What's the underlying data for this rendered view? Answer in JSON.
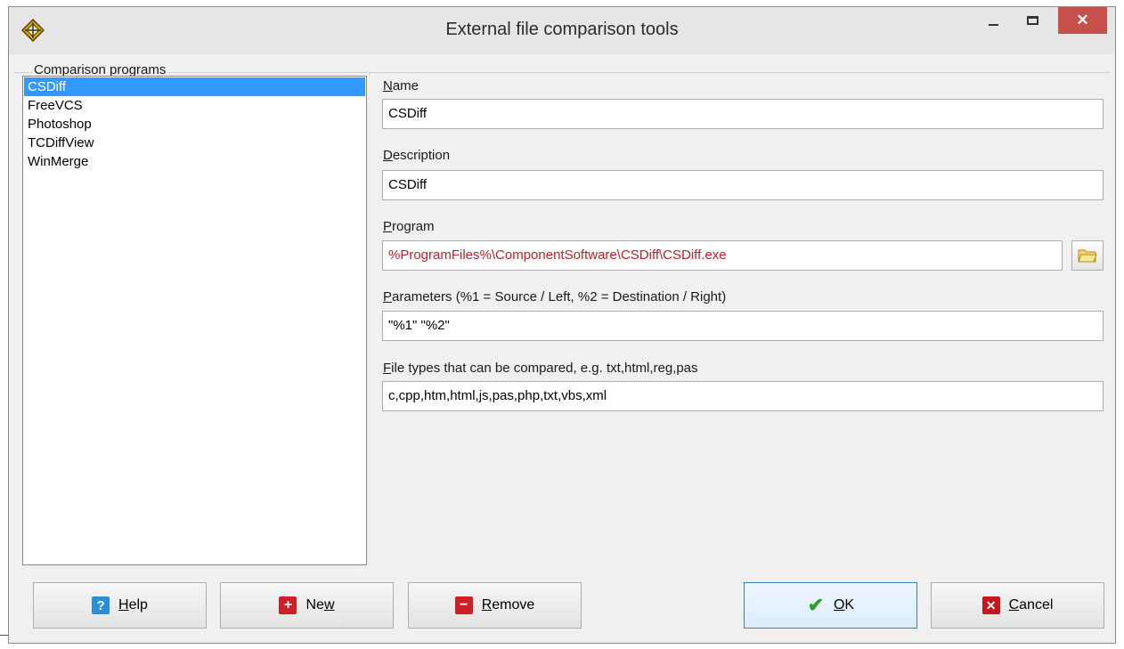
{
  "window": {
    "title": "External file comparison tools",
    "close_symbol": "✕"
  },
  "list_group": {
    "label": "Comparison programs",
    "items": [
      {
        "label": "CSDiff",
        "selected": true
      },
      {
        "label": "FreeVCS",
        "selected": false
      },
      {
        "label": "Photoshop",
        "selected": false
      },
      {
        "label": "TCDiffView",
        "selected": false
      },
      {
        "label": "WinMerge",
        "selected": false
      }
    ]
  },
  "fields": {
    "name": {
      "label_key": "N",
      "label_rest": "ame",
      "value": "CSDiff"
    },
    "description": {
      "label_key": "D",
      "label_rest": "escription",
      "value": "CSDiff"
    },
    "program": {
      "label_key": "P",
      "label_rest": "rogram",
      "value": "%ProgramFiles%\\ComponentSoftware\\CSDiff\\CSDiff.exe",
      "value_color": "#c0202a"
    },
    "parameters": {
      "label_key": "P",
      "label_rest": "arameters (%1 = Source / Left, %2 = Destination / Right)",
      "value": "\"%1\" \"%2\""
    },
    "file_types": {
      "label_key": "F",
      "label_rest": "ile types that can be compared, e.g. txt,html,reg,pas",
      "value": "c,cpp,htm,html,js,pas,php,txt,vbs,xml"
    }
  },
  "buttons": {
    "help": {
      "key": "H",
      "rest": "elp",
      "icon": "help-icon"
    },
    "new": {
      "pre": "Ne",
      "key": "w",
      "icon": "plus-icon"
    },
    "remove": {
      "key": "R",
      "rest": "emove",
      "icon": "minus-icon"
    },
    "ok": {
      "key": "O",
      "rest": "K",
      "icon": "checkmark-icon"
    },
    "cancel": {
      "key": "C",
      "rest": "ancel",
      "icon": "x-icon"
    }
  },
  "colors": {
    "selection": "#3399ff",
    "close_button": "#c7504a",
    "program_text": "#c0202a"
  }
}
